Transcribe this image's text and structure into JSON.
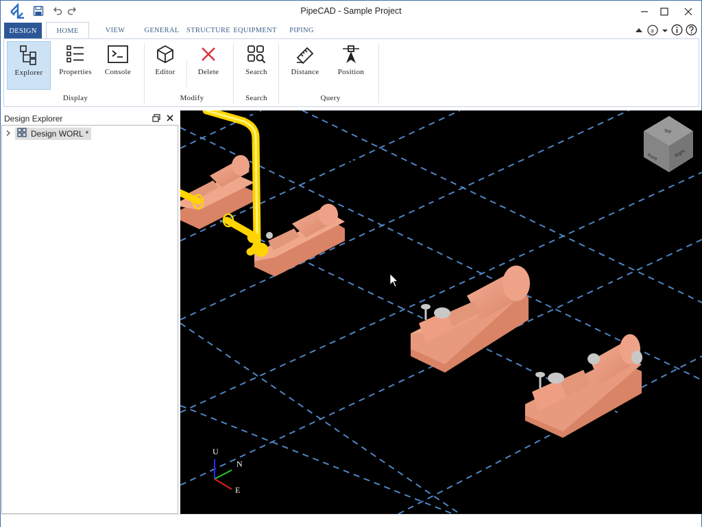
{
  "window": {
    "title": "PipeCAD - Sample Project",
    "icons": [
      "app-logo",
      "save-icon",
      "undo-icon",
      "redo-icon",
      "minimize-icon",
      "maximize-icon",
      "close-icon"
    ]
  },
  "ribbon": {
    "tabs": [
      {
        "id": "design",
        "label": "DESIGN"
      },
      {
        "id": "home",
        "label": "HOME",
        "active": true
      },
      {
        "id": "view",
        "label": "VIEW"
      },
      {
        "id": "general",
        "label": "GENERAL"
      },
      {
        "id": "structure",
        "label": "STRUCTURE"
      },
      {
        "id": "equipment",
        "label": "EQUIPMENT"
      },
      {
        "id": "piping",
        "label": "PIPING"
      }
    ],
    "groups": {
      "display": {
        "label": "Display",
        "buttons": [
          {
            "id": "explorer",
            "label": "Explorer",
            "icon": "tree-hierarchy-icon",
            "active": true
          },
          {
            "id": "properties",
            "label": "Properties",
            "icon": "property-list-icon"
          },
          {
            "id": "console",
            "label": "Console",
            "icon": "terminal-icon"
          }
        ]
      },
      "modify": {
        "label": "Modify",
        "buttons": [
          {
            "id": "editor",
            "label": "Editor",
            "icon": "cube-edit-icon"
          },
          {
            "id": "delete",
            "label": "Delete",
            "icon": "delete-x-icon"
          }
        ]
      },
      "search": {
        "label": "Search",
        "buttons": [
          {
            "id": "search",
            "label": "Search",
            "icon": "search-grid-icon"
          }
        ]
      },
      "query": {
        "label": "Query",
        "buttons": [
          {
            "id": "distance",
            "label": "Distance",
            "icon": "ruler-icon"
          },
          {
            "id": "position",
            "label": "Position",
            "icon": "position-marker-icon"
          }
        ]
      }
    }
  },
  "explorer": {
    "title": "Design Explorer",
    "tree": [
      {
        "label": "Design WORL *",
        "icon": "design-world-icon",
        "expanded": false
      }
    ]
  },
  "viewport": {
    "view_cube_faces": [
      "Top",
      "Front",
      "Right"
    ],
    "axes": {
      "up": "U",
      "north": "N",
      "east": "E"
    },
    "colors": {
      "background": "#000000",
      "grid": "#4f86c4",
      "equipment": "#e9967a",
      "pipe": "#ffd700",
      "valve_stem": "#c8c8c8"
    }
  },
  "theme": {
    "accent": "#2b5797",
    "tab_text": "#3b5f8a",
    "selected_button": "#cde3f5"
  }
}
